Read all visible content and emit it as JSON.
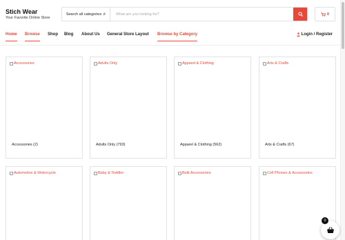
{
  "brand": {
    "title": "Stich Wear",
    "tagline": "Your Favorite Online Store",
    "accent": "#e8483a"
  },
  "search": {
    "category_label": "Search all categories",
    "placeholder": "What are you looking for?",
    "button_icon": "search-icon"
  },
  "cart": {
    "icon": "cart-icon",
    "count": "0"
  },
  "nav": {
    "items": [
      {
        "label": "Home",
        "active": true
      },
      {
        "label": "Browse",
        "active": true
      },
      {
        "label": "Shop",
        "active": false
      },
      {
        "label": "Blog",
        "active": false
      },
      {
        "label": "About Us",
        "active": false
      },
      {
        "label": "General Store Layout",
        "active": false
      },
      {
        "label": "Browse by Category",
        "active": true
      }
    ],
    "login_label": "Login / Register"
  },
  "categories": [
    {
      "image_alt": "Accessories",
      "label": "Accessories (2)"
    },
    {
      "image_alt": "Adults Only",
      "label": "Adults Only (793)"
    },
    {
      "image_alt": "Apparel & Clothing",
      "label": "Apparel & Clothing (562)"
    },
    {
      "image_alt": "Arts & Crafts",
      "label": "Arts & Crafts (67)"
    },
    {
      "image_alt": "Automotive & Motorcycle",
      "label": ""
    },
    {
      "image_alt": "Baby & Toddler",
      "label": ""
    },
    {
      "image_alt": "Bulk Accessories",
      "label": ""
    },
    {
      "image_alt": "Cell Phones & Accessories",
      "label": ""
    }
  ],
  "floating_cart": {
    "icon": "basket-icon",
    "count": "0"
  }
}
